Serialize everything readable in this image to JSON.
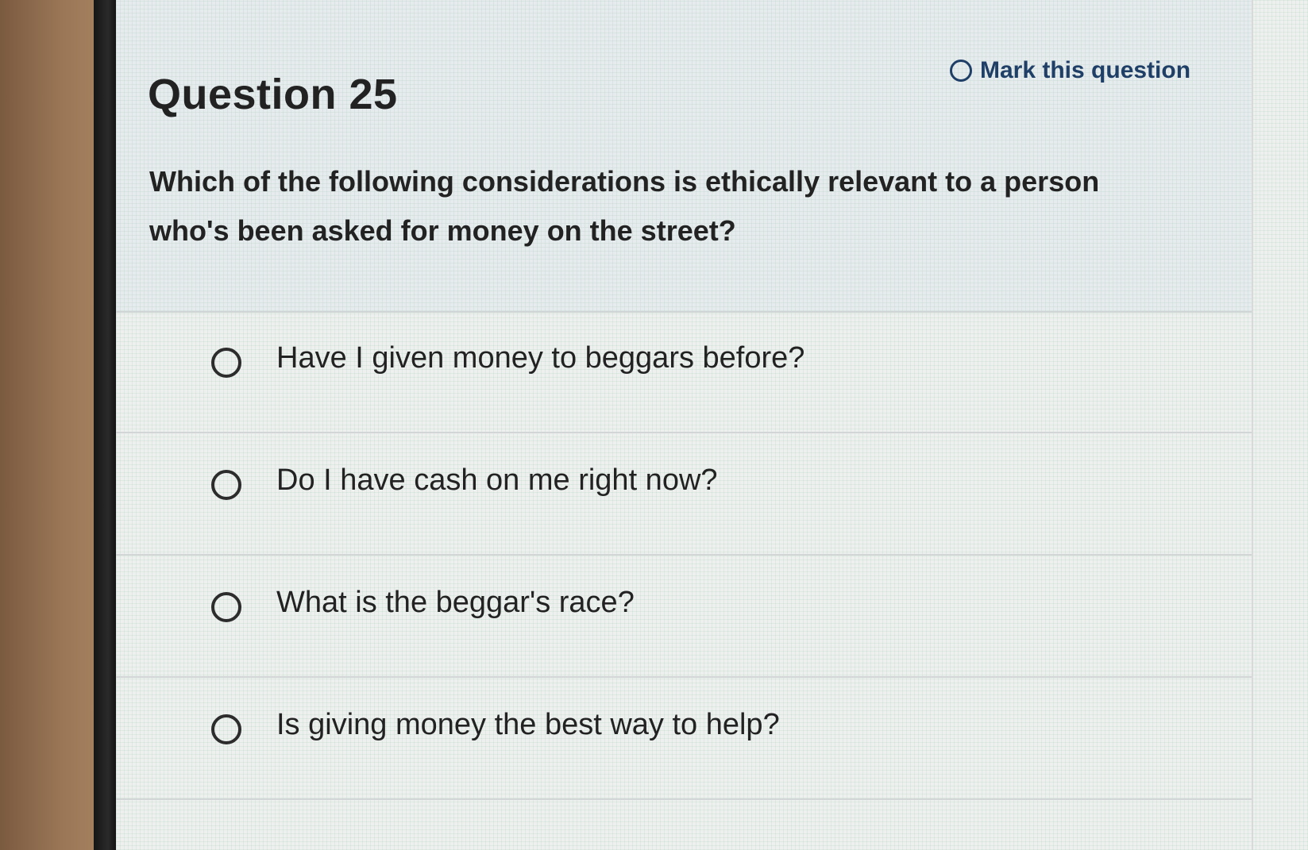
{
  "question": {
    "title": "Question 25",
    "mark_label": "Mark this question",
    "text": "Which of the following considerations is ethically relevant to a person who's been asked for money on the street?"
  },
  "options": [
    {
      "label": "Have I given money to beggars before?"
    },
    {
      "label": "Do I have cash on me right now?"
    },
    {
      "label": "What is the beggar's race?"
    },
    {
      "label": "Is giving money the best way to help?"
    }
  ]
}
